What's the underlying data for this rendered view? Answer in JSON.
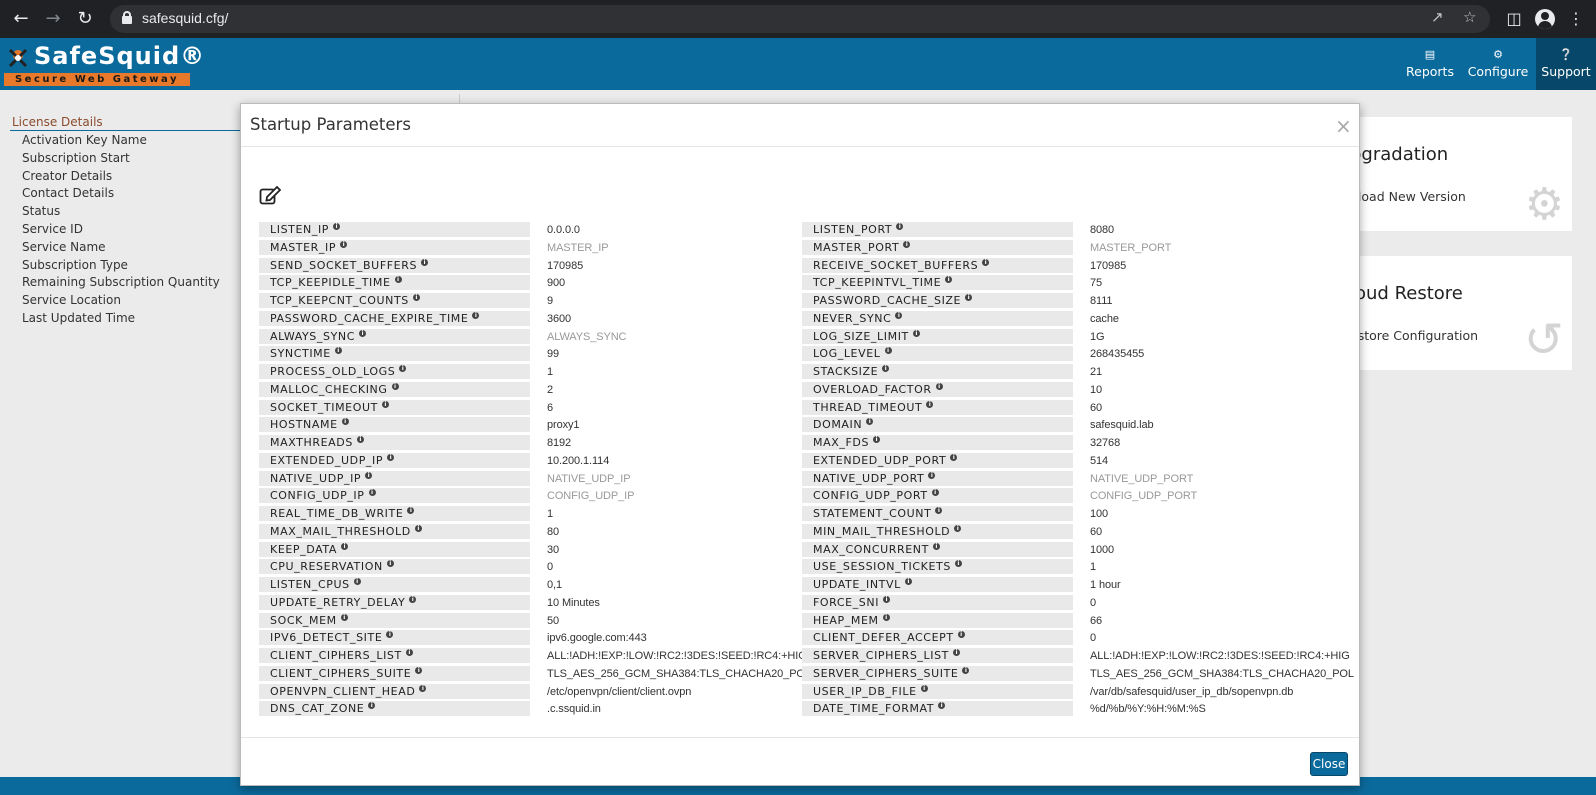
{
  "browser": {
    "url": "safesquid.cfg/"
  },
  "header": {
    "logo_text": "SafeSquid®",
    "logo_tagline": "Secure Web Gateway",
    "buttons": [
      {
        "label": "Reports",
        "icon": "chart-icon"
      },
      {
        "label": "Configure",
        "icon": "cogs-icon"
      },
      {
        "label": "Support",
        "icon": "question-icon"
      }
    ]
  },
  "license": {
    "title": "License Details",
    "items": [
      "Activation Key Name",
      "Subscription Start",
      "Creator Details",
      "Contact Details",
      "Status",
      "Service ID",
      "Service Name",
      "Subscription Type",
      "Remaining Subscription Quantity",
      "Service Location",
      "Last Updated Time"
    ]
  },
  "cards": [
    {
      "title": "pgradation",
      "sub": "pload New Version",
      "icon": "gear-icon"
    },
    {
      "title": "loud Restore",
      "sub": "estore Configuration",
      "icon": "restore-icon"
    }
  ],
  "modal": {
    "title": "Startup Parameters",
    "close_symbol": "×",
    "close_button": "Close",
    "left_params": [
      {
        "key": "LISTEN_IP",
        "value": "0.0.0.0",
        "placeholder": false
      },
      {
        "key": "MASTER_IP",
        "value": "MASTER_IP",
        "placeholder": true
      },
      {
        "key": "SEND_SOCKET_BUFFERS",
        "value": "170985",
        "placeholder": false
      },
      {
        "key": "TCP_KEEPIDLE_TIME",
        "value": "900",
        "placeholder": false
      },
      {
        "key": "TCP_KEEPCNT_COUNTS",
        "value": "9",
        "placeholder": false
      },
      {
        "key": "PASSWORD_CACHE_EXPIRE_TIME",
        "value": "3600",
        "placeholder": false
      },
      {
        "key": "ALWAYS_SYNC",
        "value": "ALWAYS_SYNC",
        "placeholder": true
      },
      {
        "key": "SYNCTIME",
        "value": "99",
        "placeholder": false
      },
      {
        "key": "PROCESS_OLD_LOGS",
        "value": "1",
        "placeholder": false
      },
      {
        "key": "MALLOC_CHECKING",
        "value": "2",
        "placeholder": false
      },
      {
        "key": "SOCKET_TIMEOUT",
        "value": "6",
        "placeholder": false
      },
      {
        "key": "HOSTNAME",
        "value": "proxy1",
        "placeholder": false
      },
      {
        "key": "MAXTHREADS",
        "value": "8192",
        "placeholder": false
      },
      {
        "key": "EXTENDED_UDP_IP",
        "value": "10.200.1.114",
        "placeholder": false
      },
      {
        "key": "NATIVE_UDP_IP",
        "value": "NATIVE_UDP_IP",
        "placeholder": true
      },
      {
        "key": "CONFIG_UDP_IP",
        "value": "CONFIG_UDP_IP",
        "placeholder": true
      },
      {
        "key": "REAL_TIME_DB_WRITE",
        "value": "1",
        "placeholder": false
      },
      {
        "key": "MAX_MAIL_THRESHOLD",
        "value": "80",
        "placeholder": false
      },
      {
        "key": "KEEP_DATA",
        "value": "30",
        "placeholder": false
      },
      {
        "key": "CPU_RESERVATION",
        "value": "0",
        "placeholder": false
      },
      {
        "key": "LISTEN_CPUS",
        "value": "0,1",
        "placeholder": false
      },
      {
        "key": "UPDATE_RETRY_DELAY",
        "value": "10 Minutes",
        "placeholder": false
      },
      {
        "key": "SOCK_MEM",
        "value": "50",
        "placeholder": false
      },
      {
        "key": "IPV6_DETECT_SITE",
        "value": "ipv6.google.com:443",
        "placeholder": false
      },
      {
        "key": "CLIENT_CIPHERS_LIST",
        "value": "ALL:!ADH:!EXP:!LOW:!RC2:!3DES:!SEED:!RC4:+HIG",
        "placeholder": false
      },
      {
        "key": "CLIENT_CIPHERS_SUITE",
        "value": "TLS_AES_256_GCM_SHA384:TLS_CHACHA20_POL",
        "placeholder": false
      },
      {
        "key": "OPENVPN_CLIENT_HEAD",
        "value": "/etc/openvpn/client/client.ovpn",
        "placeholder": false
      },
      {
        "key": "DNS_CAT_ZONE",
        "value": ".c.ssquid.in",
        "placeholder": false
      }
    ],
    "right_params": [
      {
        "key": "LISTEN_PORT",
        "value": "8080",
        "placeholder": false
      },
      {
        "key": "MASTER_PORT",
        "value": "MASTER_PORT",
        "placeholder": true
      },
      {
        "key": "RECEIVE_SOCKET_BUFFERS",
        "value": "170985",
        "placeholder": false
      },
      {
        "key": "TCP_KEEPINTVL_TIME",
        "value": "75",
        "placeholder": false
      },
      {
        "key": "PASSWORD_CACHE_SIZE",
        "value": "8111",
        "placeholder": false
      },
      {
        "key": "NEVER_SYNC",
        "value": "cache",
        "placeholder": false
      },
      {
        "key": "LOG_SIZE_LIMIT",
        "value": "1G",
        "placeholder": false
      },
      {
        "key": "LOG_LEVEL",
        "value": "268435455",
        "placeholder": false
      },
      {
        "key": "STACKSIZE",
        "value": "21",
        "placeholder": false
      },
      {
        "key": "OVERLOAD_FACTOR",
        "value": "10",
        "placeholder": false
      },
      {
        "key": "THREAD_TIMEOUT",
        "value": "60",
        "placeholder": false
      },
      {
        "key": "DOMAIN",
        "value": "safesquid.lab",
        "placeholder": false
      },
      {
        "key": "MAX_FDS",
        "value": "32768",
        "placeholder": false
      },
      {
        "key": "EXTENDED_UDP_PORT",
        "value": "514",
        "placeholder": false
      },
      {
        "key": "NATIVE_UDP_PORT",
        "value": "NATIVE_UDP_PORT",
        "placeholder": true
      },
      {
        "key": "CONFIG_UDP_PORT",
        "value": "CONFIG_UDP_PORT",
        "placeholder": true
      },
      {
        "key": "STATEMENT_COUNT",
        "value": "100",
        "placeholder": false
      },
      {
        "key": "MIN_MAIL_THRESHOLD",
        "value": "60",
        "placeholder": false
      },
      {
        "key": "MAX_CONCURRENT",
        "value": "1000",
        "placeholder": false
      },
      {
        "key": "USE_SESSION_TICKETS",
        "value": "1",
        "placeholder": false
      },
      {
        "key": "UPDATE_INTVL",
        "value": "1 hour",
        "placeholder": false
      },
      {
        "key": "FORCE_SNI",
        "value": "0",
        "placeholder": false
      },
      {
        "key": "HEAP_MEM",
        "value": "66",
        "placeholder": false
      },
      {
        "key": "CLIENT_DEFER_ACCEPT",
        "value": "0",
        "placeholder": false
      },
      {
        "key": "SERVER_CIPHERS_LIST",
        "value": "ALL:!ADH:!EXP:!LOW:!RC2:!3DES:!SEED:!RC4:+HIG",
        "placeholder": false
      },
      {
        "key": "SERVER_CIPHERS_SUITE",
        "value": "TLS_AES_256_GCM_SHA384:TLS_CHACHA20_POL",
        "placeholder": false
      },
      {
        "key": "USER_IP_DB_FILE",
        "value": "/var/db/safesquid/user_ip_db/sopenvpn.db",
        "placeholder": false
      },
      {
        "key": "DATE_TIME_FORMAT",
        "value": "%d/%b/%Y:%H:%M:%S",
        "placeholder": false
      }
    ]
  },
  "colors": {
    "brand_blue": "#0b6a9c",
    "brand_orange": "#e8792a",
    "header_active": "#07486a"
  }
}
